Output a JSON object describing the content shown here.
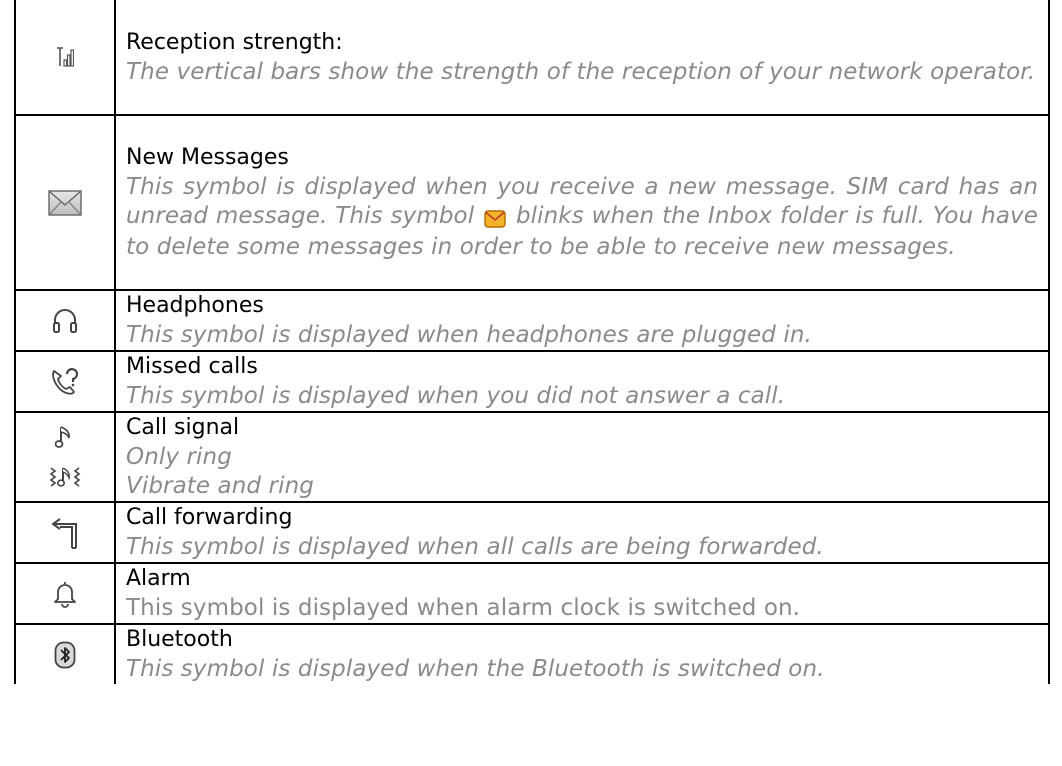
{
  "rows": [
    {
      "icon": "signal-strength-icon",
      "title": "Reception strength:",
      "lines": [
        "The vertical bars show the strength of the reception of your network operator."
      ]
    },
    {
      "icon": "envelope-icon",
      "title": "New Messages",
      "desc_before": "This symbol is displayed when you receive a new message. SIM card has an unread message. This symbol",
      "inline_icon": "envelope-blinking-icon",
      "desc_after": "blinks when the Inbox folder is full. You have to delete some messages in order to be able to receive new messages."
    },
    {
      "icon": "headphones-icon",
      "title": "Headphones",
      "lines": [
        "This symbol is displayed when headphones are plugged in."
      ]
    },
    {
      "icon": "missed-call-icon",
      "title": "Missed calls",
      "lines": [
        "This symbol is displayed when you did not answer a call."
      ]
    },
    {
      "icon": "ring-icon",
      "icon2": "vibrate-ring-icon",
      "title": "Call signal",
      "lines": [
        "Only ring",
        "Vibrate and ring"
      ]
    },
    {
      "icon": "call-forward-icon",
      "title": "Call forwarding",
      "lines": [
        "This symbol is displayed when all calls are being forwarded."
      ]
    },
    {
      "icon": "alarm-bell-icon",
      "title": "Alarm",
      "lines": [
        "This symbol is displayed when alarm clock is switched on."
      ]
    },
    {
      "icon": "bluetooth-icon",
      "title": "Bluetooth",
      "lines": [
        "This symbol is displayed when the Bluetooth is switched on."
      ]
    }
  ]
}
